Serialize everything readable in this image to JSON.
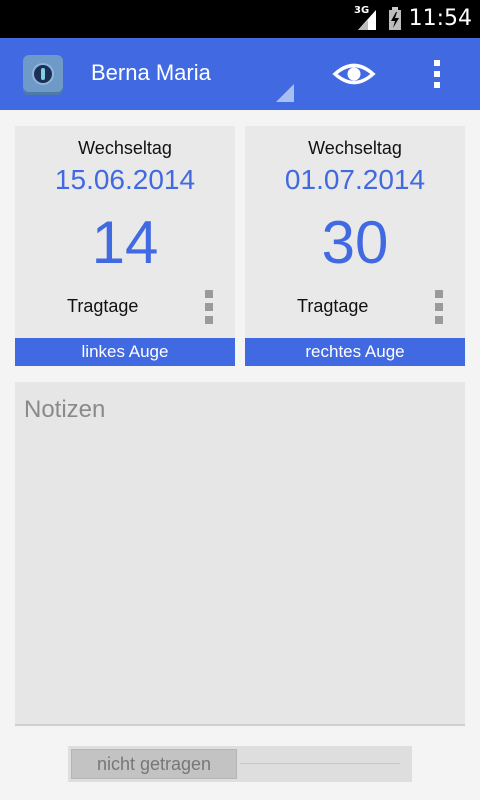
{
  "status_bar": {
    "network": "3G",
    "time": "11:54",
    "icons": [
      "signal-icon",
      "battery-icon"
    ]
  },
  "action_bar": {
    "patient_name": "Berna Maria",
    "icons": {
      "app": "contact-lens-app-icon",
      "view": "eye-icon",
      "menu": "overflow-menu-icon"
    }
  },
  "cards": [
    {
      "change_label": "Wechseltag",
      "change_date": "15.06.2014",
      "days": "14",
      "days_label": "Tragtage",
      "eye_label": "linkes Auge"
    },
    {
      "change_label": "Wechseltag",
      "change_date": "01.07.2014",
      "days": "30",
      "days_label": "Tragtage",
      "eye_label": "rechtes Auge"
    }
  ],
  "notes": {
    "placeholder": "Notizen"
  },
  "toggle": {
    "label": "nicht getragen",
    "state": "off"
  },
  "colors": {
    "accent": "#4169e1",
    "card_bg": "#e9e9e9",
    "status_bar": "#000000"
  }
}
